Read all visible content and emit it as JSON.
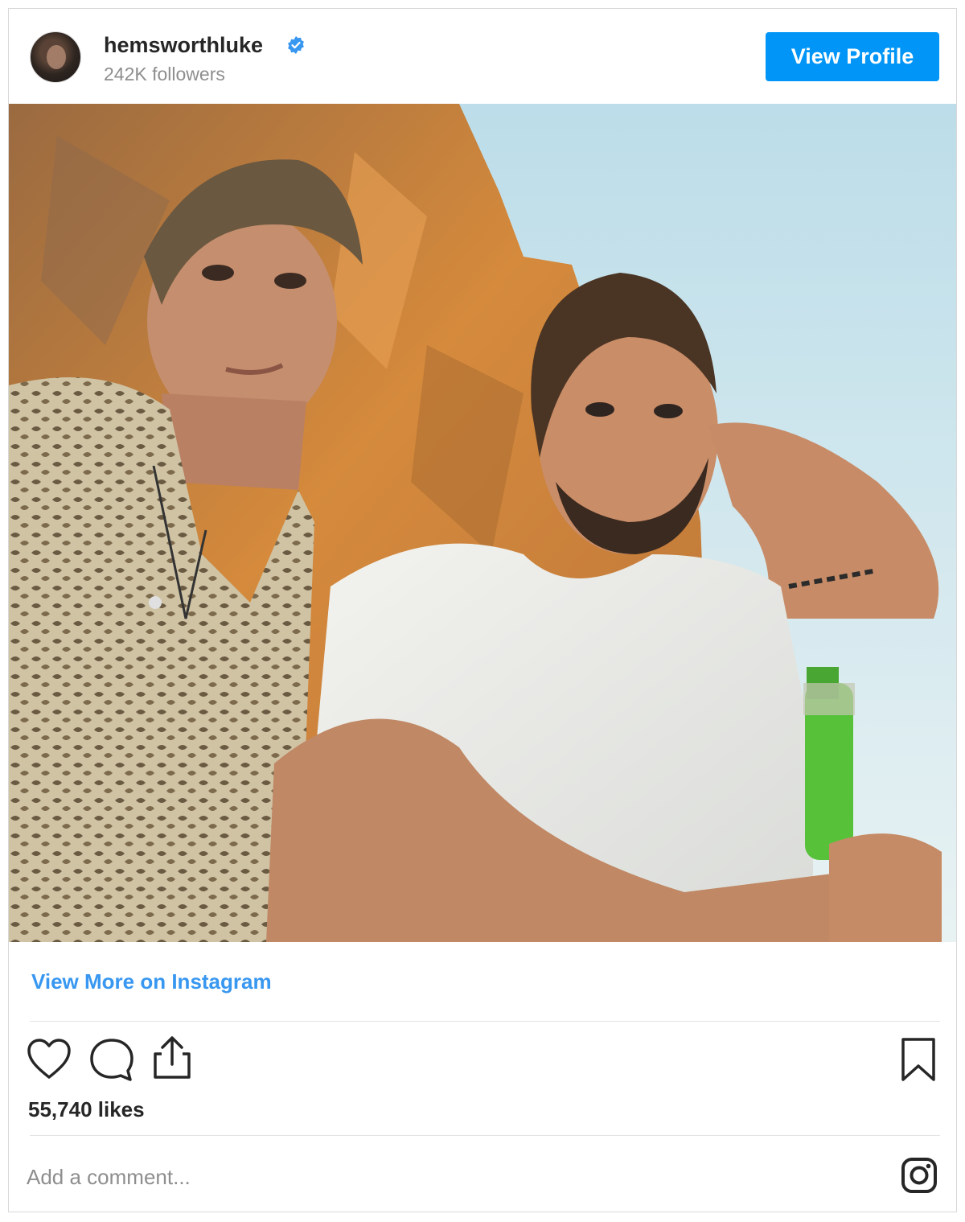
{
  "header": {
    "username": "hemsworthluke",
    "followers": "242K followers",
    "view_profile_label": "View Profile"
  },
  "post": {
    "view_more_label": "View More on Instagram",
    "likes": "55,740 likes"
  },
  "comment": {
    "placeholder": "Add a comment..."
  },
  "colors": {
    "accent": "#0095f6",
    "link": "#3897f0"
  },
  "icons": [
    "verified-badge-icon",
    "heart-icon",
    "comment-icon",
    "share-icon",
    "bookmark-icon",
    "instagram-logo-icon"
  ]
}
